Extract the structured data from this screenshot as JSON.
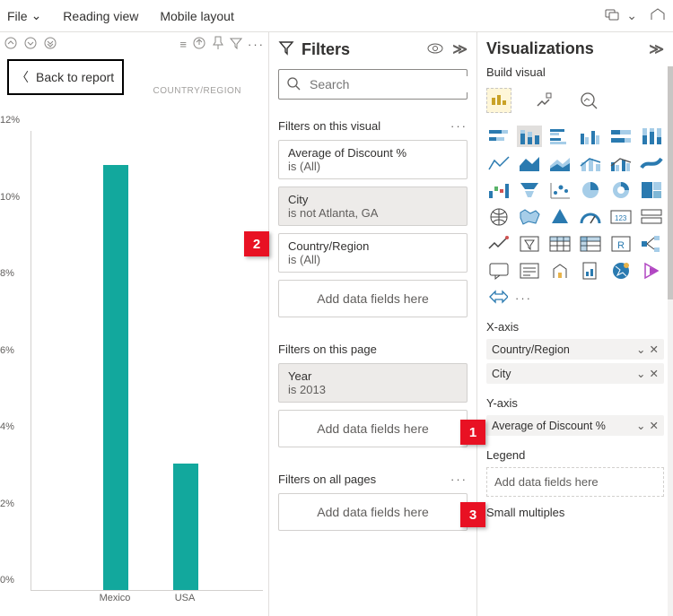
{
  "ribbon": {
    "file": "File",
    "view1": "Reading view",
    "view2": "Mobile layout"
  },
  "canvas": {
    "back": "Back to report",
    "truncated_label": "COUNTRY/REGION"
  },
  "chart_data": {
    "type": "bar",
    "categories": [
      "Mexico",
      "USA"
    ],
    "values": [
      11.1,
      3.3
    ],
    "title": "",
    "xlabel": "",
    "ylabel": "",
    "ylim": [
      0,
      12
    ],
    "yticks": [
      0,
      2,
      4,
      6,
      8,
      10,
      12
    ],
    "ytick_labels": [
      "0%",
      "2%",
      "4%",
      "6%",
      "8%",
      "10%",
      "12%"
    ]
  },
  "filters": {
    "title": "Filters",
    "search_placeholder": "Search",
    "visual_section": "Filters on this visual",
    "page_section": "Filters on this page",
    "all_section": "Filters on all pages",
    "add_hint": "Add data fields here",
    "visual_filters": [
      {
        "name": "Average of Discount %",
        "value": "is (All)",
        "highlight": false
      },
      {
        "name": "City",
        "value": "is not Atlanta, GA",
        "highlight": true
      },
      {
        "name": "Country/Region",
        "value": "is (All)",
        "highlight": false
      }
    ],
    "page_filters": [
      {
        "name": "Year",
        "value": "is 2013",
        "highlight": true
      }
    ]
  },
  "viz": {
    "title": "Visualizations",
    "build": "Build visual",
    "xaxis_label": "X-axis",
    "yaxis_label": "Y-axis",
    "legend_label": "Legend",
    "small_label": "Small multiples",
    "xaxis_fields": [
      "Country/Region",
      "City"
    ],
    "yaxis_fields": [
      "Average of Discount %"
    ],
    "add_hint": "Add data fields here"
  },
  "callouts": {
    "c1": "1",
    "c2": "2",
    "c3": "3"
  }
}
